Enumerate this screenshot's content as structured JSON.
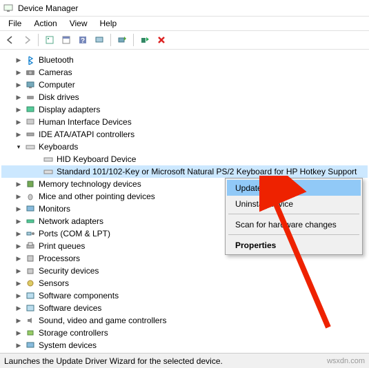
{
  "title": "Device Manager",
  "menu": {
    "file": "File",
    "action": "Action",
    "view": "View",
    "help": "Help"
  },
  "tree": {
    "bluetooth": "Bluetooth",
    "cameras": "Cameras",
    "computer": "Computer",
    "disk_drives": "Disk drives",
    "display_adapters": "Display adapters",
    "hid": "Human Interface Devices",
    "ide": "IDE ATA/ATAPI controllers",
    "keyboards": "Keyboards",
    "keyboards_children": {
      "hid_kb": "HID Keyboard Device",
      "std_kb": "Standard 101/102-Key or Microsoft Natural PS/2 Keyboard for HP Hotkey Support"
    },
    "memory": "Memory technology devices",
    "mice": "Mice and other pointing devices",
    "monitors": "Monitors",
    "network": "Network adapters",
    "ports": "Ports (COM & LPT)",
    "print_queues": "Print queues",
    "processors": "Processors",
    "security": "Security devices",
    "sensors": "Sensors",
    "software_components": "Software components",
    "software_devices": "Software devices",
    "svg": "Sound, video and game controllers",
    "storage": "Storage controllers",
    "system": "System devices"
  },
  "context_menu": {
    "update_driver": "Update driver",
    "uninstall": "Uninstall device",
    "scan": "Scan for hardware changes",
    "properties": "Properties"
  },
  "status_text": "Launches the Update Driver Wizard for the selected device.",
  "watermark": "wsxdn.com"
}
